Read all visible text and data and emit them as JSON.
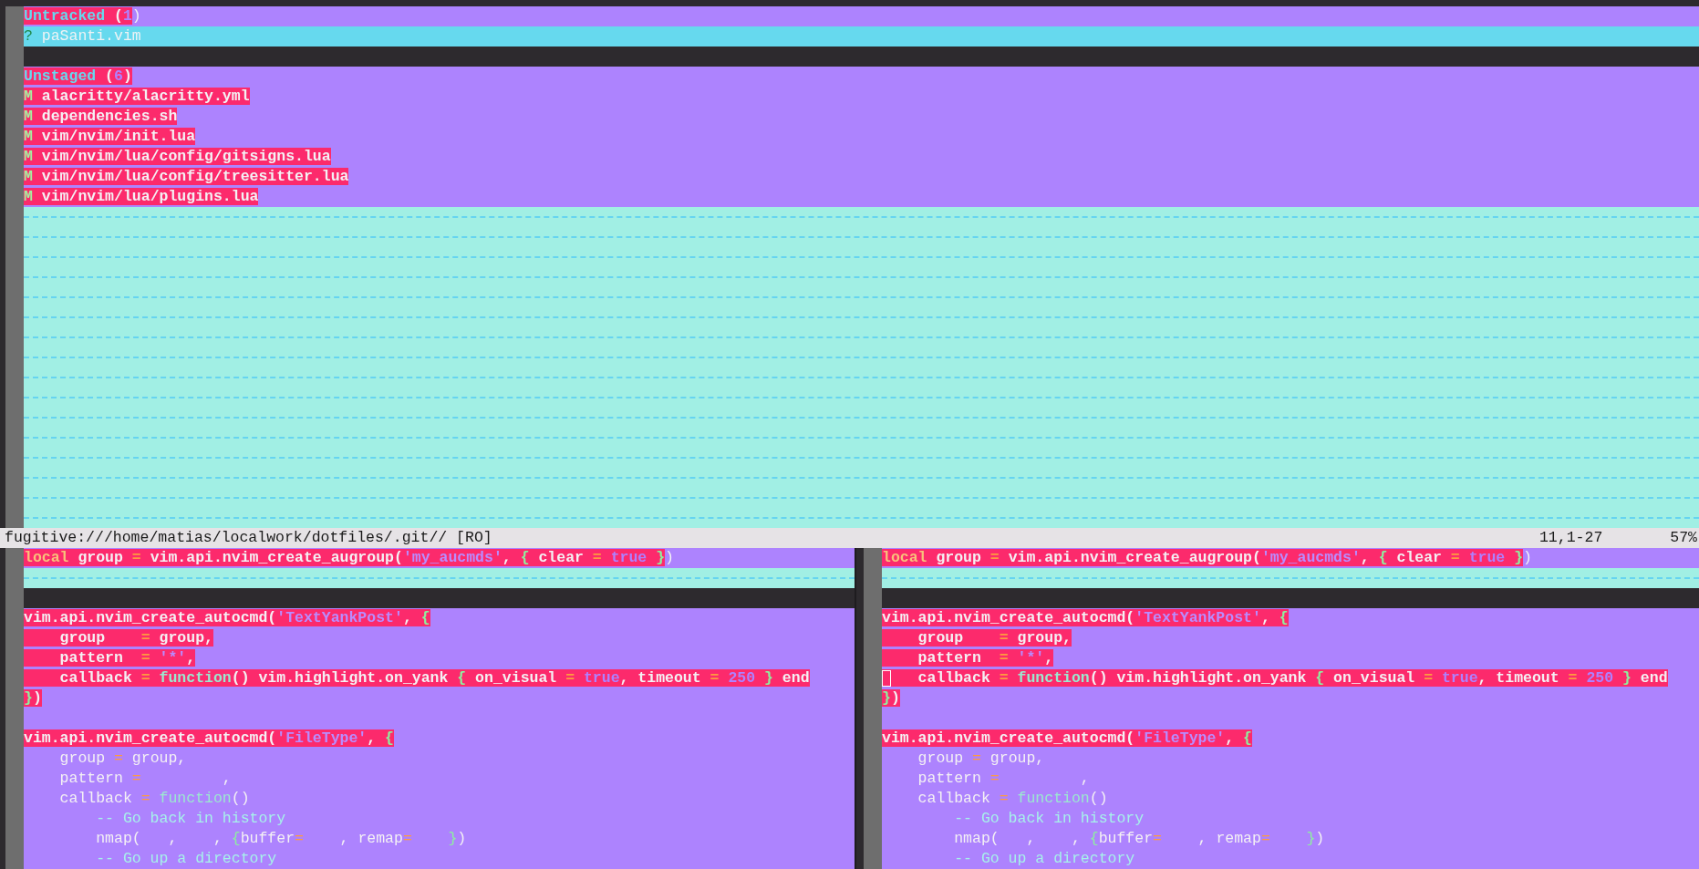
{
  "top_window": {
    "lines": [
      {
        "kind": "changed",
        "tokens": [
          {
            "text": "Untracked",
            "kind": "heading",
            "changed": true
          },
          {
            "text": " (",
            "kind": "plain",
            "changed": true
          },
          {
            "text": "1",
            "kind": "count",
            "changed": true
          },
          {
            "text": ")",
            "kind": "plain",
            "changed": false
          }
        ]
      },
      {
        "kind": "added",
        "tokens": [
          {
            "text": "?",
            "kind": "sign",
            "changed": false
          },
          {
            "text": " paSanti.vim",
            "kind": "faint",
            "changed": false
          }
        ]
      },
      {
        "kind": "empty"
      },
      {
        "kind": "changed",
        "tokens": [
          {
            "text": "Unstaged",
            "kind": "heading",
            "changed": true
          },
          {
            "text": " (",
            "kind": "plain",
            "changed": true
          },
          {
            "text": "6",
            "kind": "count",
            "changed": true
          },
          {
            "text": ")",
            "kind": "plain",
            "changed": true
          }
        ]
      },
      {
        "kind": "changed",
        "tokens": [
          {
            "text": "M",
            "kind": "sign",
            "changed": true
          },
          {
            "text": " alacritty/alacritty.yml",
            "kind": "plain",
            "changed": true
          }
        ]
      },
      {
        "kind": "changed",
        "tokens": [
          {
            "text": "M",
            "kind": "sign",
            "changed": true
          },
          {
            "text": " dependencies.sh",
            "kind": "plain",
            "changed": true
          }
        ]
      },
      {
        "kind": "changed",
        "tokens": [
          {
            "text": "M",
            "kind": "sign",
            "changed": true
          },
          {
            "text": " vim/nvim/init.lua",
            "kind": "plain",
            "changed": true
          }
        ]
      },
      {
        "kind": "changed",
        "tokens": [
          {
            "text": "M",
            "kind": "sign",
            "changed": true
          },
          {
            "text": " vim/nvim/lua/config/gitsigns.lua",
            "kind": "plain",
            "changed": true
          }
        ]
      },
      {
        "kind": "changed",
        "tokens": [
          {
            "text": "M",
            "kind": "sign",
            "changed": true
          },
          {
            "text": " vim/nvim/lua/config/treesitter.lua",
            "kind": "plain",
            "changed": true
          }
        ]
      },
      {
        "kind": "changed",
        "tokens": [
          {
            "text": "M",
            "kind": "sign",
            "changed": true
          },
          {
            "text": " vim/nvim/lua/plugins.lua",
            "kind": "plain",
            "changed": true
          }
        ]
      },
      {
        "kind": "filler"
      },
      {
        "kind": "filler"
      },
      {
        "kind": "filler"
      },
      {
        "kind": "filler"
      },
      {
        "kind": "filler"
      },
      {
        "kind": "filler"
      },
      {
        "kind": "filler"
      },
      {
        "kind": "filler"
      },
      {
        "kind": "filler"
      },
      {
        "kind": "filler"
      },
      {
        "kind": "filler"
      },
      {
        "kind": "filler"
      },
      {
        "kind": "filler"
      },
      {
        "kind": "filler"
      },
      {
        "kind": "filler"
      },
      {
        "kind": "filler"
      }
    ]
  },
  "status_bar": {
    "path": "fugitive:///home/matias/localwork/dotfiles/.git// [RO]",
    "position": "11,1-27",
    "percent": "57%"
  },
  "bottom_windows": [
    {
      "lines": [
        {
          "kind": "changed",
          "cursor": false,
          "tokens": [
            {
              "text": "local",
              "kind": "keyword",
              "changed": true
            },
            {
              "text": " group ",
              "kind": "plain",
              "changed": true
            },
            {
              "text": "=",
              "kind": "operator",
              "changed": true
            },
            {
              "text": " vim.api.nvim_create_augroup(",
              "kind": "plain",
              "changed": true
            },
            {
              "text": "'my_aucmds'",
              "kind": "string",
              "changed": true
            },
            {
              "text": ", ",
              "kind": "plain",
              "changed": true
            },
            {
              "text": "{",
              "kind": "brace",
              "changed": true
            },
            {
              "text": " clear ",
              "kind": "plain",
              "changed": true
            },
            {
              "text": "=",
              "kind": "operator",
              "changed": true
            },
            {
              "text": " true",
              "kind": "constant",
              "changed": true
            },
            {
              "text": " }",
              "kind": "brace",
              "changed": true
            },
            {
              "text": ")",
              "kind": "plain",
              "changed": false
            }
          ]
        },
        {
          "kind": "filler"
        },
        {
          "kind": "empty"
        },
        {
          "kind": "changed",
          "cursor": false,
          "tokens": [
            {
              "text": "vim.api.nvim_create_autocmd(",
              "kind": "plain",
              "changed": true
            },
            {
              "text": "'TextYankPost'",
              "kind": "string",
              "changed": true
            },
            {
              "text": ", ",
              "kind": "plain",
              "changed": true
            },
            {
              "text": "{",
              "kind": "brace",
              "changed": true
            }
          ]
        },
        {
          "kind": "changed",
          "cursor": false,
          "tokens": [
            {
              "text": "    group    ",
              "kind": "plain",
              "changed": true
            },
            {
              "text": "=",
              "kind": "operator",
              "changed": true
            },
            {
              "text": " group,",
              "kind": "plain",
              "changed": true
            }
          ]
        },
        {
          "kind": "changed",
          "cursor": false,
          "tokens": [
            {
              "text": "    pattern  ",
              "kind": "plain",
              "changed": true
            },
            {
              "text": "=",
              "kind": "operator",
              "changed": true
            },
            {
              "text": " '*'",
              "kind": "string",
              "changed": true
            },
            {
              "text": ",",
              "kind": "plain",
              "changed": true
            }
          ]
        },
        {
          "kind": "changed",
          "cursor": false,
          "tokens": [
            {
              "text": "    callback ",
              "kind": "plain",
              "changed": true
            },
            {
              "text": "=",
              "kind": "operator",
              "changed": true
            },
            {
              "text": " function",
              "kind": "function",
              "changed": true
            },
            {
              "text": "() vim.highlight.on_yank ",
              "kind": "plain",
              "changed": true
            },
            {
              "text": "{",
              "kind": "brace",
              "changed": true
            },
            {
              "text": " on_visual ",
              "kind": "plain",
              "changed": true
            },
            {
              "text": "=",
              "kind": "operator",
              "changed": true
            },
            {
              "text": " true",
              "kind": "constant",
              "changed": true
            },
            {
              "text": ", timeout ",
              "kind": "plain",
              "changed": true
            },
            {
              "text": "=",
              "kind": "operator",
              "changed": true
            },
            {
              "text": " 250",
              "kind": "constant",
              "changed": true
            },
            {
              "text": " }",
              "kind": "brace",
              "changed": true
            },
            {
              "text": " end",
              "kind": "plain",
              "changed": true
            }
          ]
        },
        {
          "kind": "changed",
          "cursor": false,
          "tokens": [
            {
              "text": "}",
              "kind": "brace",
              "changed": true
            },
            {
              "text": ")",
              "kind": "plain",
              "changed": true
            }
          ]
        },
        {
          "kind": "changed",
          "cursor": false
        },
        {
          "kind": "changed",
          "cursor": false,
          "tokens": [
            {
              "text": "vim.api.nvim_create_autocmd(",
              "kind": "plain",
              "changed": true
            },
            {
              "text": "'FileType'",
              "kind": "string",
              "changed": true
            },
            {
              "text": ", ",
              "kind": "plain",
              "changed": true
            },
            {
              "text": "{",
              "kind": "brace",
              "changed": true
            }
          ]
        },
        {
          "kind": "changed",
          "cursor": false,
          "tokens": [
            {
              "text": "    group ",
              "kind": "plain",
              "changed": false
            },
            {
              "text": "=",
              "kind": "operator",
              "changed": false
            },
            {
              "text": " group,",
              "kind": "plain",
              "changed": false
            }
          ]
        },
        {
          "kind": "changed",
          "cursor": false,
          "tokens": [
            {
              "text": "    pattern ",
              "kind": "plain",
              "changed": false
            },
            {
              "text": "=",
              "kind": "operator",
              "changed": false
            },
            {
              "text": "         ,",
              "kind": "plain",
              "changed": false
            }
          ]
        },
        {
          "kind": "changed",
          "cursor": false,
          "tokens": [
            {
              "text": "    callback ",
              "kind": "plain",
              "changed": false
            },
            {
              "text": "=",
              "kind": "operator",
              "changed": false
            },
            {
              "text": " function",
              "kind": "function",
              "changed": false
            },
            {
              "text": "()",
              "kind": "plain",
              "changed": false
            }
          ]
        },
        {
          "kind": "changed",
          "cursor": false,
          "tokens": [
            {
              "text": "        -- Go back in history",
              "kind": "comment",
              "changed": false
            }
          ]
        },
        {
          "kind": "changed",
          "cursor": false,
          "tokens": [
            {
              "text": "        nmap(   ,    , ",
              "kind": "plain",
              "changed": false
            },
            {
              "text": "{",
              "kind": "brace",
              "changed": false
            },
            {
              "text": "buffer",
              "kind": "plain",
              "changed": false
            },
            {
              "text": "=",
              "kind": "operator",
              "changed": false
            },
            {
              "text": "    , remap",
              "kind": "plain",
              "changed": false
            },
            {
              "text": "=",
              "kind": "operator",
              "changed": false
            },
            {
              "text": "    }",
              "kind": "brace",
              "changed": false
            },
            {
              "text": ")",
              "kind": "plain",
              "changed": false
            }
          ]
        },
        {
          "kind": "changed",
          "cursor": false,
          "tokens": [
            {
              "text": "        -- Go up a directory",
              "kind": "comment",
              "changed": false
            }
          ]
        }
      ]
    },
    {
      "lines": [
        {
          "kind": "changed",
          "cursor": false,
          "tokens": [
            {
              "text": "local",
              "kind": "keyword",
              "changed": true
            },
            {
              "text": " group ",
              "kind": "plain",
              "changed": true
            },
            {
              "text": "=",
              "kind": "operator",
              "changed": true
            },
            {
              "text": " vim.api.nvim_create_augroup(",
              "kind": "plain",
              "changed": true
            },
            {
              "text": "'my_aucmds'",
              "kind": "string",
              "changed": true
            },
            {
              "text": ", ",
              "kind": "plain",
              "changed": true
            },
            {
              "text": "{",
              "kind": "brace",
              "changed": true
            },
            {
              "text": " clear ",
              "kind": "plain",
              "changed": true
            },
            {
              "text": "=",
              "kind": "operator",
              "changed": true
            },
            {
              "text": " true",
              "kind": "constant",
              "changed": true
            },
            {
              "text": " }",
              "kind": "brace",
              "changed": true
            },
            {
              "text": ")",
              "kind": "plain",
              "changed": false
            }
          ]
        },
        {
          "kind": "filler"
        },
        {
          "kind": "empty"
        },
        {
          "kind": "changed",
          "cursor": false,
          "tokens": [
            {
              "text": "vim.api.nvim_create_autocmd(",
              "kind": "plain",
              "changed": true
            },
            {
              "text": "'TextYankPost'",
              "kind": "string",
              "changed": true
            },
            {
              "text": ", ",
              "kind": "plain",
              "changed": true
            },
            {
              "text": "{",
              "kind": "brace",
              "changed": true
            }
          ]
        },
        {
          "kind": "changed",
          "cursor": false,
          "tokens": [
            {
              "text": "    group    ",
              "kind": "plain",
              "changed": true
            },
            {
              "text": "=",
              "kind": "operator",
              "changed": true
            },
            {
              "text": " group,",
              "kind": "plain",
              "changed": true
            }
          ]
        },
        {
          "kind": "changed",
          "cursor": false,
          "tokens": [
            {
              "text": "    pattern  ",
              "kind": "plain",
              "changed": true
            },
            {
              "text": "=",
              "kind": "operator",
              "changed": true
            },
            {
              "text": " '*'",
              "kind": "string",
              "changed": true
            },
            {
              "text": ",",
              "kind": "plain",
              "changed": true
            }
          ]
        },
        {
          "kind": "changed",
          "cursor": true,
          "tokens": [
            {
              "text": "    callback ",
              "kind": "plain",
              "changed": true
            },
            {
              "text": "=",
              "kind": "operator",
              "changed": true
            },
            {
              "text": " function",
              "kind": "function",
              "changed": true
            },
            {
              "text": "() vim.highlight.on_yank ",
              "kind": "plain",
              "changed": true
            },
            {
              "text": "{",
              "kind": "brace",
              "changed": true
            },
            {
              "text": " on_visual ",
              "kind": "plain",
              "changed": true
            },
            {
              "text": "=",
              "kind": "operator",
              "changed": true
            },
            {
              "text": " true",
              "kind": "constant",
              "changed": true
            },
            {
              "text": ", timeout ",
              "kind": "plain",
              "changed": true
            },
            {
              "text": "=",
              "kind": "operator",
              "changed": true
            },
            {
              "text": " 250",
              "kind": "constant",
              "changed": true
            },
            {
              "text": " }",
              "kind": "brace",
              "changed": true
            },
            {
              "text": " end",
              "kind": "plain",
              "changed": true
            }
          ]
        },
        {
          "kind": "changed",
          "cursor": false,
          "tokens": [
            {
              "text": "}",
              "kind": "brace",
              "changed": true
            },
            {
              "text": ")",
              "kind": "plain",
              "changed": true
            }
          ]
        },
        {
          "kind": "changed",
          "cursor": false
        },
        {
          "kind": "changed",
          "cursor": false,
          "tokens": [
            {
              "text": "vim.api.nvim_create_autocmd(",
              "kind": "plain",
              "changed": true
            },
            {
              "text": "'FileType'",
              "kind": "string",
              "changed": true
            },
            {
              "text": ", ",
              "kind": "plain",
              "changed": true
            },
            {
              "text": "{",
              "kind": "brace",
              "changed": true
            }
          ]
        },
        {
          "kind": "changed",
          "cursor": false,
          "tokens": [
            {
              "text": "    group ",
              "kind": "plain",
              "changed": false
            },
            {
              "text": "=",
              "kind": "operator",
              "changed": false
            },
            {
              "text": " group,",
              "kind": "plain",
              "changed": false
            }
          ]
        },
        {
          "kind": "changed",
          "cursor": false,
          "tokens": [
            {
              "text": "    pattern ",
              "kind": "plain",
              "changed": false
            },
            {
              "text": "=",
              "kind": "operator",
              "changed": false
            },
            {
              "text": "         ,",
              "kind": "plain",
              "changed": false
            }
          ]
        },
        {
          "kind": "changed",
          "cursor": false,
          "tokens": [
            {
              "text": "    callback ",
              "kind": "plain",
              "changed": false
            },
            {
              "text": "=",
              "kind": "operator",
              "changed": false
            },
            {
              "text": " function",
              "kind": "function",
              "changed": false
            },
            {
              "text": "()",
              "kind": "plain",
              "changed": false
            }
          ]
        },
        {
          "kind": "changed",
          "cursor": false,
          "tokens": [
            {
              "text": "        -- Go back in history",
              "kind": "comment",
              "changed": false
            }
          ]
        },
        {
          "kind": "changed",
          "cursor": false,
          "tokens": [
            {
              "text": "        nmap(   ,    , ",
              "kind": "plain",
              "changed": false
            },
            {
              "text": "{",
              "kind": "brace",
              "changed": false
            },
            {
              "text": "buffer",
              "kind": "plain",
              "changed": false
            },
            {
              "text": "=",
              "kind": "operator",
              "changed": false
            },
            {
              "text": "    , remap",
              "kind": "plain",
              "changed": false
            },
            {
              "text": "=",
              "kind": "operator",
              "changed": false
            },
            {
              "text": "    }",
              "kind": "brace",
              "changed": false
            },
            {
              "text": ")",
              "kind": "plain",
              "changed": false
            }
          ]
        },
        {
          "kind": "changed",
          "cursor": false,
          "tokens": [
            {
              "text": "        -- Go up a directory",
              "kind": "comment",
              "changed": false
            }
          ]
        }
      ]
    }
  ]
}
